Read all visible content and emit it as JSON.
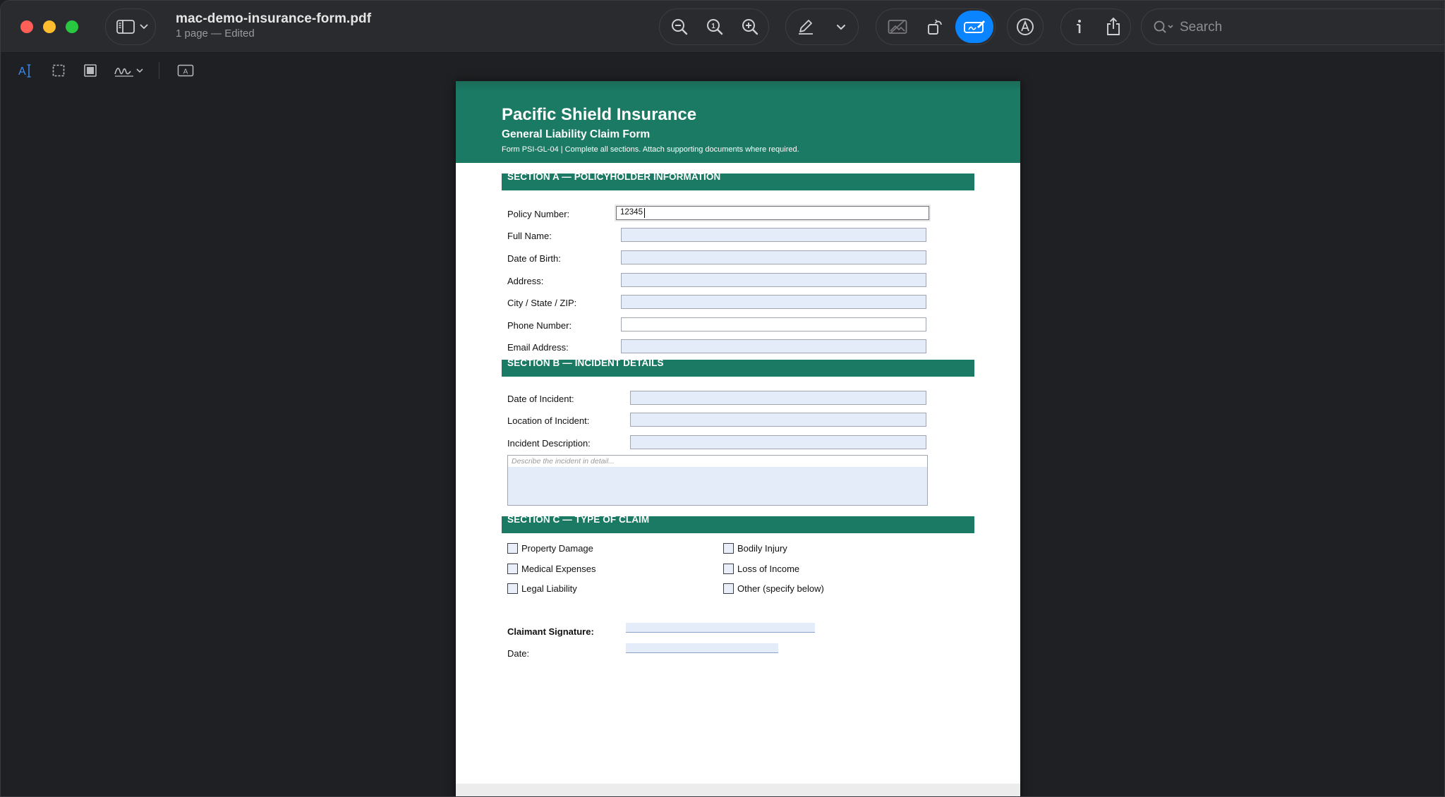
{
  "window": {
    "doc_title": "mac-demo-insurance-form.pdf",
    "doc_subtitle": "1 page — Edited"
  },
  "toolbar": {
    "sidebar_toggle_icon": "sidebar-icon",
    "zoom_out_icon": "zoom-out-icon",
    "actual_size_icon": "actual-size-icon",
    "zoom_in_icon": "zoom-in-icon",
    "highlight_icon": "pen-icon",
    "rotate_icon": "rotate-icon",
    "markup_icon": "markup-icon",
    "annotate_icon": "annotate-icon",
    "info_icon": "info-icon",
    "share_icon": "share-icon",
    "search_placeholder": "Search",
    "accent": "#0a84ff"
  },
  "markup": {
    "text_select_label": "A"
  },
  "form": {
    "company": "Pacific Shield Insurance",
    "title": "General Liability Claim Form",
    "subtitle": "Form PSI-GL-04  |  Complete all sections. Attach supporting documents where required.",
    "brand_color": "#1b7a63",
    "section_a": {
      "heading": "SECTION A — POLICYHOLDER INFORMATION",
      "fields": [
        {
          "label": "Policy Number:",
          "value": "12345"
        },
        {
          "label": "Full Name:",
          "value": ""
        },
        {
          "label": "Date of Birth:",
          "value": ""
        },
        {
          "label": "Address:",
          "value": ""
        },
        {
          "label": "City / State / ZIP:",
          "value": ""
        },
        {
          "label": "Phone Number:",
          "value": ""
        },
        {
          "label": "Email Address:",
          "value": ""
        }
      ]
    },
    "section_b": {
      "heading": "SECTION B — INCIDENT DETAILS",
      "fields": [
        {
          "label": "Date of Incident:",
          "value": ""
        },
        {
          "label": "Location of Incident:",
          "value": ""
        },
        {
          "label": "Incident Description:",
          "value": ""
        }
      ],
      "description_placeholder": "Describe the incident in detail..."
    },
    "section_c": {
      "heading": "SECTION C — TYPE OF CLAIM",
      "options_left": [
        "Property Damage",
        "Medical Expenses",
        "Legal Liability"
      ],
      "options_right": [
        "Bodily Injury",
        "Loss of Income",
        "Other (specify below)"
      ]
    },
    "signature_label": "Claimant Signature:",
    "date_label": "Date:"
  }
}
